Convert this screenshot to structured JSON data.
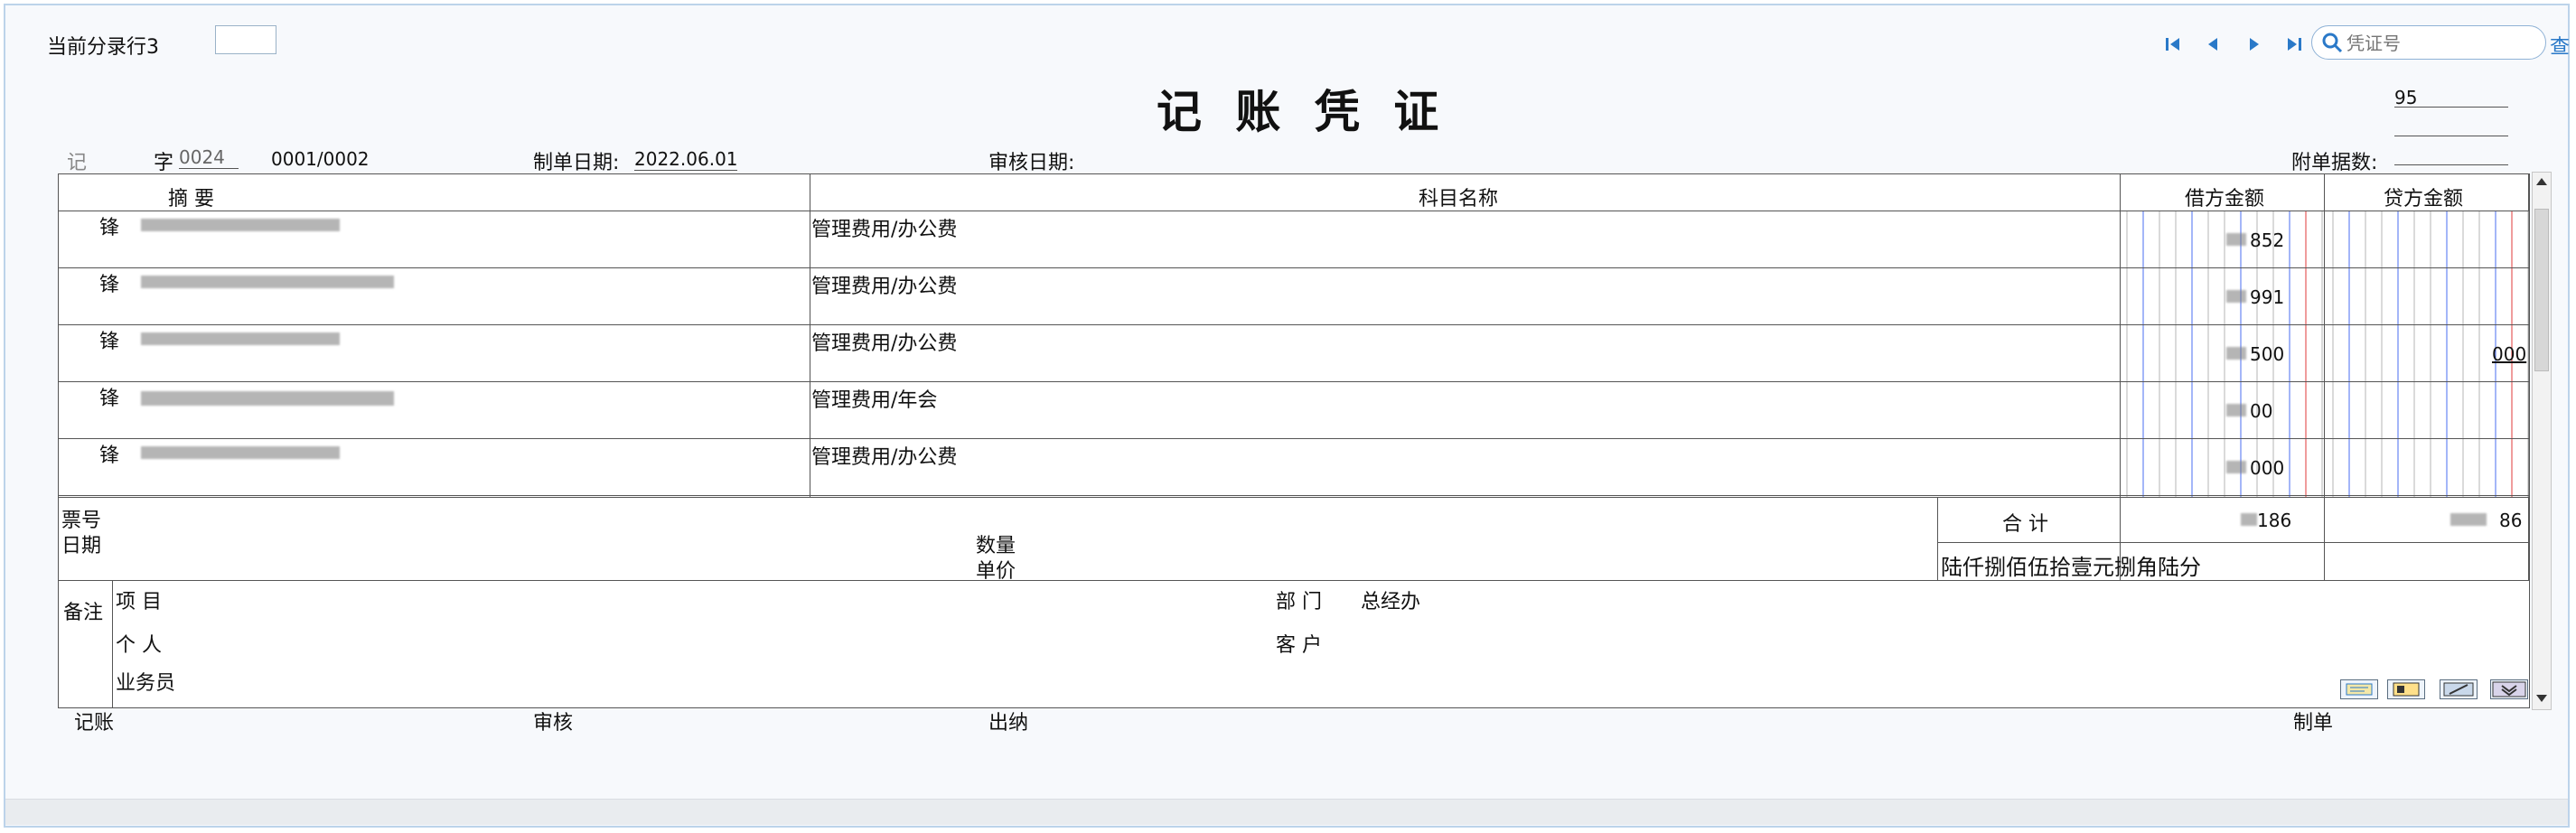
{
  "window": {
    "title": ""
  },
  "header": {
    "current_row_label": "当前分录行3",
    "current_row_input": "",
    "voucher_title": "记 账 凭 证",
    "search_placeholder": "凭证号",
    "search_button": "查",
    "top_right_number": "95"
  },
  "meta": {
    "voucher_type": "记",
    "zi_label": "字",
    "voucher_number": "0024",
    "page": "0001/0002",
    "date_label": "制单日期:",
    "date_value": "2022.06.01",
    "audit_date_label": "审核日期:",
    "attachment_label": "附单据数:"
  },
  "table": {
    "headers": {
      "summary": "摘 要",
      "account": "科目名称",
      "debit": "借方金额",
      "credit": "贷方金额"
    },
    "rows": [
      {
        "summary": "锋",
        "account": "管理费用/办公费",
        "debit": "852",
        "credit": ""
      },
      {
        "summary": "锋",
        "account": "管理费用/办公费",
        "debit": "991",
        "credit": ""
      },
      {
        "summary": "锋",
        "account": "管理费用/办公费",
        "debit": "500",
        "credit": "000"
      },
      {
        "summary": "锋",
        "account": "管理费用/年会",
        "debit": "00",
        "credit": ""
      },
      {
        "summary": "锋",
        "account": "管理费用/办公费",
        "debit": "000",
        "credit": ""
      }
    ],
    "bill_no_label": "票号",
    "date_label": "日期",
    "qty_label": "数量",
    "unit_price_label": "单价",
    "total_label": "合 计",
    "total_debit": "186",
    "total_credit": "86",
    "amount_in_words": "陆仟捌佰伍拾壹元捌角陆分"
  },
  "remarks": {
    "label": "备注",
    "project_label": "项 目",
    "department_label": "部 门",
    "department_value": "总经办",
    "personal_label": "个 人",
    "customer_label": "客 户",
    "salesperson_label": "业务员"
  },
  "footer": {
    "bookkeeping_label": "记账",
    "audit_label": "审核",
    "cashier_label": "出纳",
    "maker_label": "制单"
  },
  "icons": [
    "first-page-icon",
    "prev-page-icon",
    "next-page-icon",
    "last-page-icon",
    "search-icon",
    "note-icon",
    "card-icon",
    "tool-icon",
    "expand-down-icon"
  ]
}
